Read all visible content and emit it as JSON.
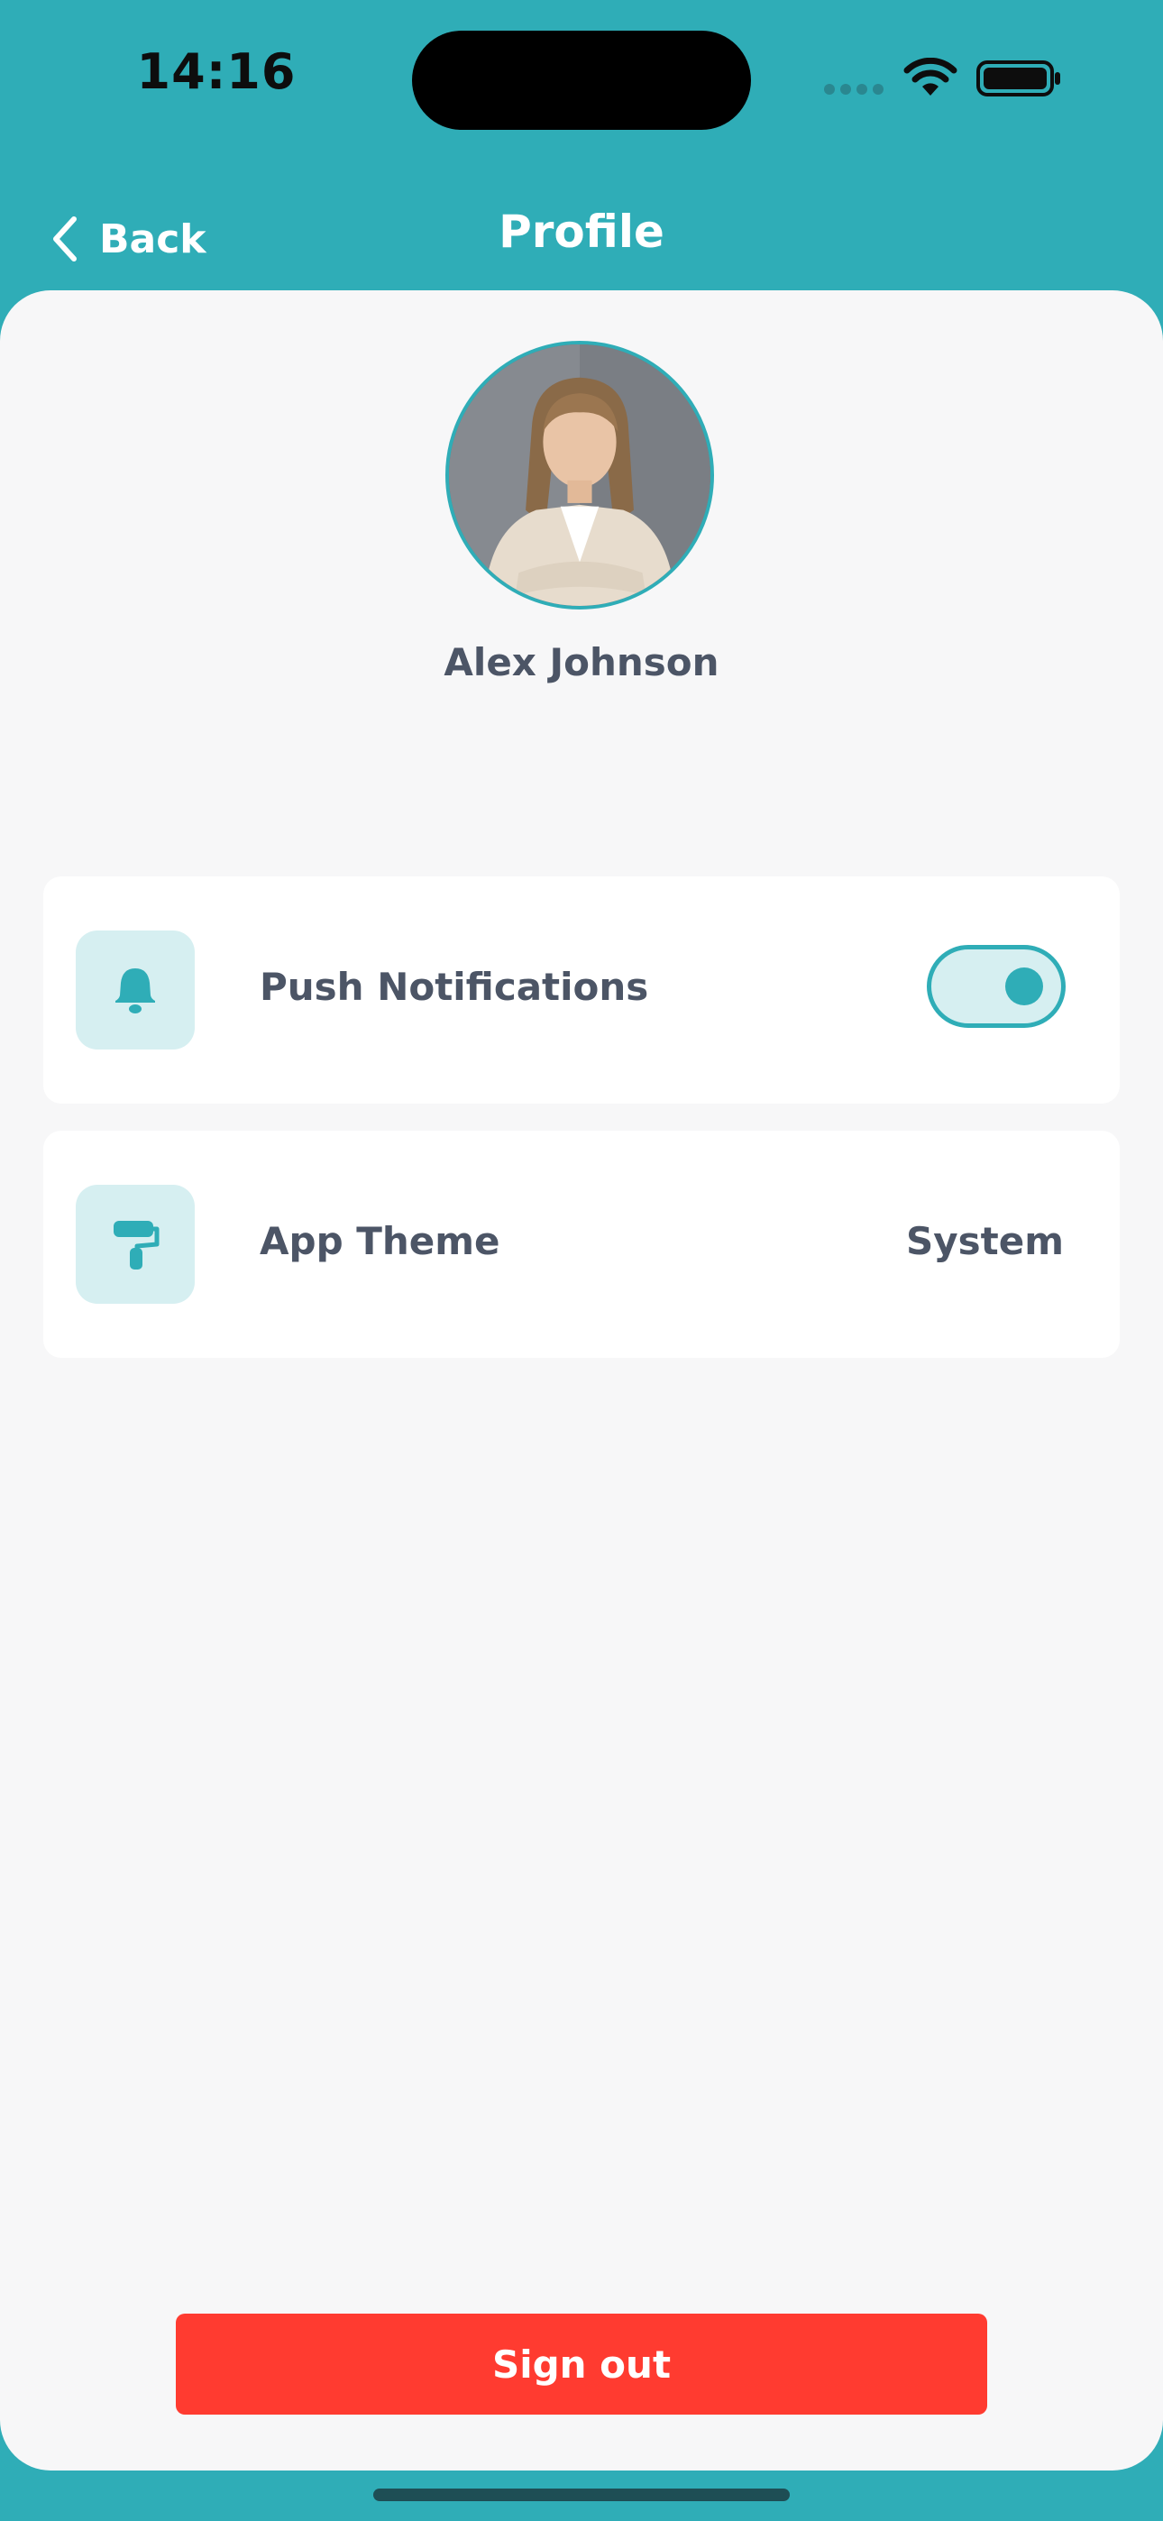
{
  "status_bar": {
    "time": "14:16",
    "signal_icon": "cellular-dots-icon",
    "wifi_icon": "wifi-icon",
    "battery_icon": "battery-icon"
  },
  "nav": {
    "back_icon": "chevron-left-icon",
    "back_label": "Back",
    "title": "Profile"
  },
  "profile": {
    "avatar_icon": "profile-photo",
    "name": "Alex Johnson"
  },
  "settings": [
    {
      "icon": "bell-icon",
      "label": "Push Notifications",
      "control": "toggle",
      "enabled": true
    },
    {
      "icon": "paint-roller-icon",
      "label": "App Theme",
      "value": "System"
    }
  ],
  "actions": {
    "sign_out_label": "Sign out"
  },
  "colors": {
    "accent": "#2fadb7",
    "accent_light": "#d6eff1",
    "danger": "#ff3b30",
    "text": "#4c5566",
    "background": "#f7f7f8"
  }
}
